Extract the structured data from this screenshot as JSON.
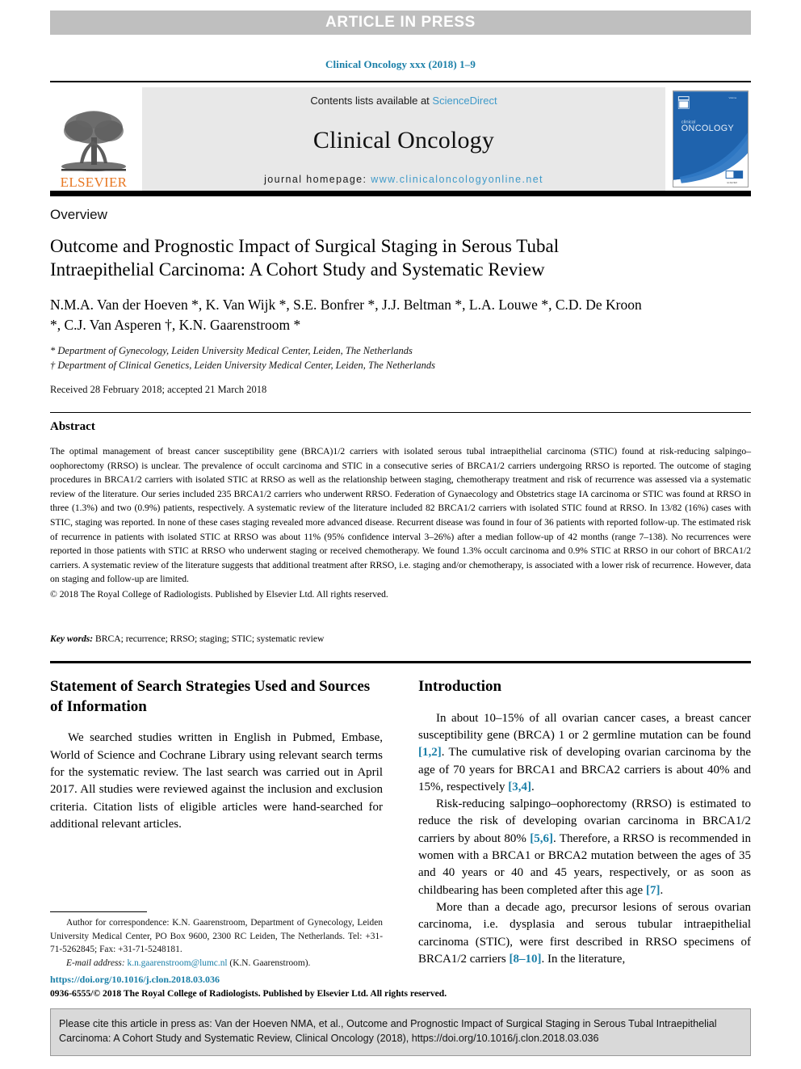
{
  "banner": {
    "text": "ARTICLE IN PRESS"
  },
  "running_head": "Clinical Oncology xxx (2018) 1–9",
  "masthead": {
    "elsevier_wordmark": "ELSEVIER",
    "contents_prefix": "Contents lists available at ",
    "sciencedirect_link": "ScienceDirect",
    "journal_name": "Clinical Oncology",
    "homepage_prefix": "journal homepage: ",
    "homepage_link": "www.clinicaloncologyonline.net",
    "cover_title_small": "clinical",
    "cover_title_large": "ONCOLOGY",
    "link_color": "#3f9ac9",
    "elsevier_orange": "#e87722",
    "band_bg": "#e8e8e8"
  },
  "article": {
    "type_label": "Overview",
    "title": "Outcome and Prognostic Impact of Surgical Staging in Serous Tubal Intraepithelial Carcinoma: A Cohort Study and Systematic Review",
    "authors": "N.M.A. Van der Hoeven *, K. Van Wijk *, S.E. Bonfrer *, J.J. Beltman *, L.A. Louwe *, C.D. De Kroon *, C.J. Van Asperen †, K.N. Gaarenstroom *",
    "affiliation_1": "* Department of Gynecology, Leiden University Medical Center, Leiden, The Netherlands",
    "affiliation_2": "† Department of Clinical Genetics, Leiden University Medical Center, Leiden, The Netherlands",
    "received": "Received 28 February 2018; accepted 21 March 2018"
  },
  "abstract": {
    "heading": "Abstract",
    "body": "The optimal management of breast cancer susceptibility gene (BRCA)1/2 carriers with isolated serous tubal intraepithelial carcinoma (STIC) found at risk-reducing salpingo–oophorectomy (RRSO) is unclear. The prevalence of occult carcinoma and STIC in a consecutive series of BRCA1/2 carriers undergoing RRSO is reported. The outcome of staging procedures in BRCA1/2 carriers with isolated STIC at RRSO as well as the relationship between staging, chemotherapy treatment and risk of recurrence was assessed via a systematic review of the literature. Our series included 235 BRCA1/2 carriers who underwent RRSO. Federation of Gynaecology and Obstetrics stage IA carcinoma or STIC was found at RRSO in three (1.3%) and two (0.9%) patients, respectively. A systematic review of the literature included 82 BRCA1/2 carriers with isolated STIC found at RRSO. In 13/82 (16%) cases with STIC, staging was reported. In none of these cases staging revealed more advanced disease. Recurrent disease was found in four of 36 patients with reported follow-up. The estimated risk of recurrence in patients with isolated STIC at RRSO was about 11% (95% confidence interval 3–26%) after a median follow-up of 42 months (range 7–138). No recurrences were reported in those patients with STIC at RRSO who underwent staging or received chemotherapy. We found 1.3% occult carcinoma and 0.9% STIC at RRSO in our cohort of BRCA1/2 carriers. A systematic review of the literature suggests that additional treatment after RRSO, i.e. staging and/or chemotherapy, is associated with a lower risk of recurrence. However, data on staging and follow-up are limited.",
    "copyright": "© 2018 The Royal College of Radiologists. Published by Elsevier Ltd. All rights reserved.",
    "keywords_label": "Key words:",
    "keywords_value": " BRCA; recurrence; RRSO; staging; STIC; systematic review"
  },
  "left_column": {
    "heading": "Statement of Search Strategies Used and Sources of Information",
    "paragraph_1": "We searched studies written in English in Pubmed, Embase, World of Science and Cochrane Library using relevant search terms for the systematic review. The last search was carried out in April 2017. All studies were reviewed against the inclusion and exclusion criteria. Citation lists of eligible articles were hand-searched for additional relevant articles."
  },
  "right_column": {
    "heading": "Introduction",
    "paragraph_1_a": "In about 10–15% of all ovarian cancer cases, a breast cancer susceptibility gene (BRCA) 1 or 2 germline mutation can be found ",
    "paragraph_1_ref1": "[1,2]",
    "paragraph_1_b": ". The cumulative risk of developing ovarian carcinoma by the age of 70 years for BRCA1 and BRCA2 carriers is about 40% and 15%, respectively ",
    "paragraph_1_ref2": "[3,4]",
    "paragraph_1_c": ".",
    "paragraph_2_a": "Risk-reducing salpingo–oophorectomy (RRSO) is estimated to reduce the risk of developing ovarian carcinoma in BRCA1/2 carriers by about 80% ",
    "paragraph_2_ref1": "[5,6]",
    "paragraph_2_b": ". Therefore, a RRSO is recommended in women with a BRCA1 or BRCA2 mutation between the ages of 35 and 40 years or 40 and 45 years, respectively, or as soon as childbearing has been completed after this age ",
    "paragraph_2_ref2": "[7]",
    "paragraph_2_c": ".",
    "paragraph_3_a": "More than a decade ago, precursor lesions of serous ovarian carcinoma, i.e. dysplasia and serous tubular intraepithelial carcinoma (STIC), were first described in RRSO specimens of BRCA1/2 carriers ",
    "paragraph_3_ref1": "[8–10]",
    "paragraph_3_b": ". In the literature,"
  },
  "footnote": {
    "correspondence": "Author for correspondence: K.N. Gaarenstroom, Department of Gynecology, Leiden University Medical Center, PO Box 9600, 2300 RC Leiden, The Netherlands. Tel: +31-71-5262845; Fax: +31-71-5248181.",
    "email_label": "E-mail address:",
    "email_link": " k.n.gaarenstroom@lumc.nl",
    "email_suffix": " (K.N. Gaarenstroom)."
  },
  "doi": {
    "link": "https://doi.org/10.1016/j.clon.2018.03.036",
    "issn_line": "0936-6555/© 2018 The Royal College of Radiologists. Published by Elsevier Ltd. All rights reserved."
  },
  "cite_box": {
    "text": "Please cite this article in press as: Van der Hoeven NMA, et al., Outcome and Prognostic Impact of Surgical Staging in Serous Tubal Intraepithelial Carcinoma: A Cohort Study and Systematic Review, Clinical Oncology (2018), https://doi.org/10.1016/j.clon.2018.03.036"
  }
}
